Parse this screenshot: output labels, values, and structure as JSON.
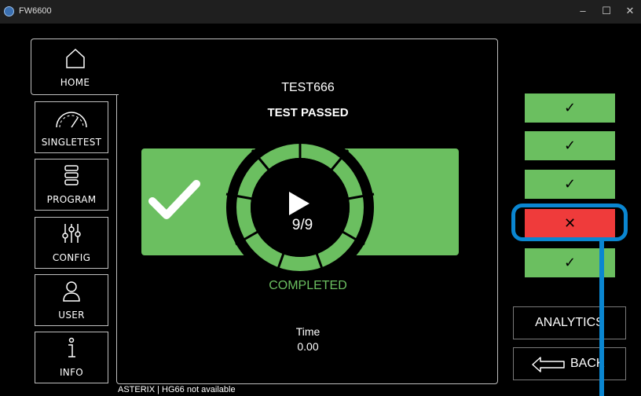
{
  "window": {
    "title": "FW6600",
    "minimize_glyph": "–",
    "maximize_glyph": "☐",
    "close_glyph": "✕"
  },
  "nav": {
    "items": [
      {
        "label": "HOME",
        "icon": "home-icon"
      },
      {
        "label": "SINGLETEST",
        "icon": "gauge-icon"
      },
      {
        "label": "PROGRAM",
        "icon": "list-icon"
      },
      {
        "label": "CONFIG",
        "icon": "sliders-icon"
      },
      {
        "label": "USER",
        "icon": "user-icon"
      },
      {
        "label": "INFO",
        "icon": "info-icon"
      }
    ]
  },
  "test": {
    "name": "TEST666",
    "status": "TEST PASSED",
    "counter": "9/9",
    "state": "COMPLETED",
    "time_label": "Time",
    "time_value": "0.00"
  },
  "results": [
    {
      "glyph": "✓",
      "status": "pass"
    },
    {
      "glyph": "✓",
      "status": "pass"
    },
    {
      "glyph": "✓",
      "status": "pass"
    },
    {
      "glyph": "✕",
      "status": "fail"
    },
    {
      "glyph": "✓",
      "status": "pass"
    }
  ],
  "actions": {
    "analytics_label": "ANALYTICS",
    "back_label": "BACK"
  },
  "footer": {
    "text": "ASTERIX | HG66 not available"
  },
  "colors": {
    "pass_green": "#6bbf60",
    "fail_red": "#ef3b3b",
    "highlight_blue": "#0a86d1"
  }
}
